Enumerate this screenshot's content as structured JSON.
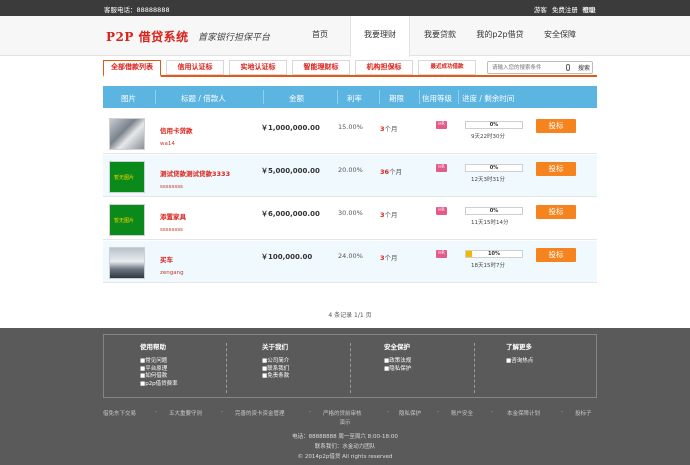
{
  "topbar": {
    "phone": "客服电话：88888888",
    "links": [
      "游客",
      "免费注册",
      "登录"
    ],
    "help": "帮助"
  },
  "header": {
    "logo": "P2P 借贷系统",
    "slogan": "首家银行担保平台",
    "nav": [
      "首页",
      "我要理财",
      "我要贷款",
      "我的p2p借贷",
      "安全保障"
    ],
    "nav_active": 1
  },
  "tabs": [
    "全部借款列表",
    "信用认证标",
    "实地认证标",
    "智能理财标",
    "机构担保标",
    "最近成功借款"
  ],
  "search": {
    "placeholder": "请输入您的搜索条件",
    "button": "搜索"
  },
  "table": {
    "headers": [
      "图片",
      "标题 / 借款人",
      "金额",
      "利率",
      "期限",
      "信用等级",
      "进度 / 剩余时间"
    ],
    "rows": [
      {
        "thumb": "photo",
        "thumb_text": "",
        "title": "信用卡贷款",
        "user": "wa14",
        "amount": "￥1,000,000.00",
        "rate": "15.00%",
        "term_num": "3",
        "term_unit": "个月",
        "grade": "HR",
        "progress": 0,
        "progress_label": "0%",
        "time_left": "9天22时30分",
        "action": "投标"
      },
      {
        "thumb": "green",
        "thumb_text": "暂无图片",
        "title": "测试贷款测试贷款3333",
        "user": "ssssssss",
        "amount": "￥5,000,000.00",
        "rate": "20.00%",
        "term_num": "36",
        "term_unit": "个月",
        "grade": "HR",
        "progress": 0,
        "progress_label": "0%",
        "time_left": "12天3时31分",
        "action": "投标"
      },
      {
        "thumb": "green",
        "thumb_text": "暂无图片",
        "title": "添置家具",
        "user": "ssssssss",
        "amount": "￥6,000,000.00",
        "rate": "30.00%",
        "term_num": "3",
        "term_unit": "个月",
        "grade": "HR",
        "progress": 0,
        "progress_label": "0%",
        "time_left": "11天15时14分",
        "action": "投标"
      },
      {
        "thumb": "car",
        "thumb_text": "",
        "title": "买车",
        "user": "zengang",
        "amount": "￥100,000.00",
        "rate": "24.00%",
        "term_num": "3",
        "term_unit": "个月",
        "grade": "HR",
        "progress": 10,
        "progress_label": "10%",
        "time_left": "18天15时7分",
        "action": "投标"
      }
    ]
  },
  "pager": "4 条记录 1/1 页",
  "footer": {
    "columns": [
      {
        "title": "使用帮助",
        "items": [
          "■常见问题",
          "■平台原理",
          "■如何借款",
          "■p2p借贷费率"
        ]
      },
      {
        "title": "关于我们",
        "items": [
          "■公司简介",
          "■联系我们",
          "■免责条款"
        ]
      },
      {
        "title": "安全保护",
        "items": [
          "■政策法规",
          "■隐私保护"
        ]
      },
      {
        "title": "了解更多",
        "items": [
          "■咨询热点"
        ]
      }
    ],
    "bottom_links": [
      "借免东下交易",
      "五大重要守则",
      "完善的资卡资金管理",
      "严格的贷前审核",
      "隐私保护",
      "账户安全",
      "本金保障计划",
      "投标子"
    ],
    "bottom_links_tail": "演示",
    "info": [
      "电话：88888888  周一至周六 8:00-18:00",
      "联系我们：水金动力团队",
      "© 2014p2p借贷 All rights reserved"
    ]
  },
  "colors": {
    "accent": "#d9221a",
    "header_blue": "#5cb4e0",
    "button_orange": "#f5841f",
    "footer_bg": "#5a5a5a"
  }
}
